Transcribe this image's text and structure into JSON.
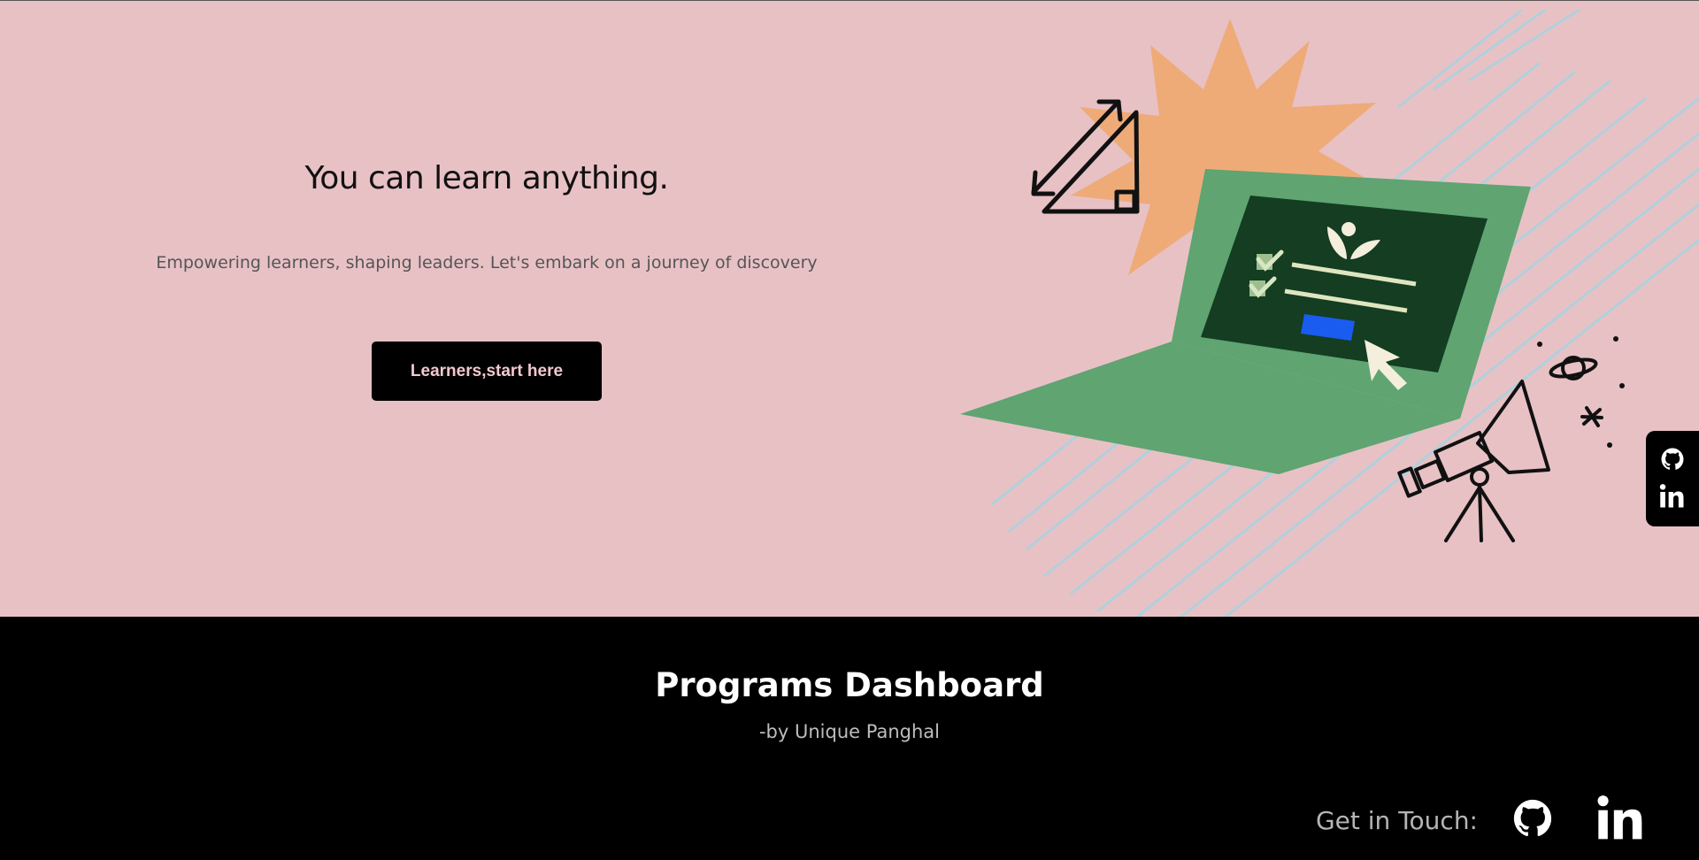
{
  "hero": {
    "title": "You can learn anything.",
    "subtitle": "Empowering learners, shaping leaders. Let's embark on a journey of discovery",
    "cta_label": "Learners,start here"
  },
  "side_tab": {
    "icons": [
      "github-icon",
      "linkedin-icon"
    ]
  },
  "footer": {
    "title": "Programs Dashboard",
    "byline": "-by Unique Panghal",
    "touch_label": "Get in Touch:",
    "icons": [
      "github-icon",
      "linkedin-icon"
    ]
  },
  "colors": {
    "hero_bg": "#e8c1c5",
    "footer_bg": "#000000",
    "button_bg": "#000000",
    "button_text": "#f2c9cf",
    "laptop_green": "#5fa471",
    "screen_green": "#143d22",
    "burst_orange": "#eeab78",
    "accent_blue": "#1a5cf0"
  }
}
